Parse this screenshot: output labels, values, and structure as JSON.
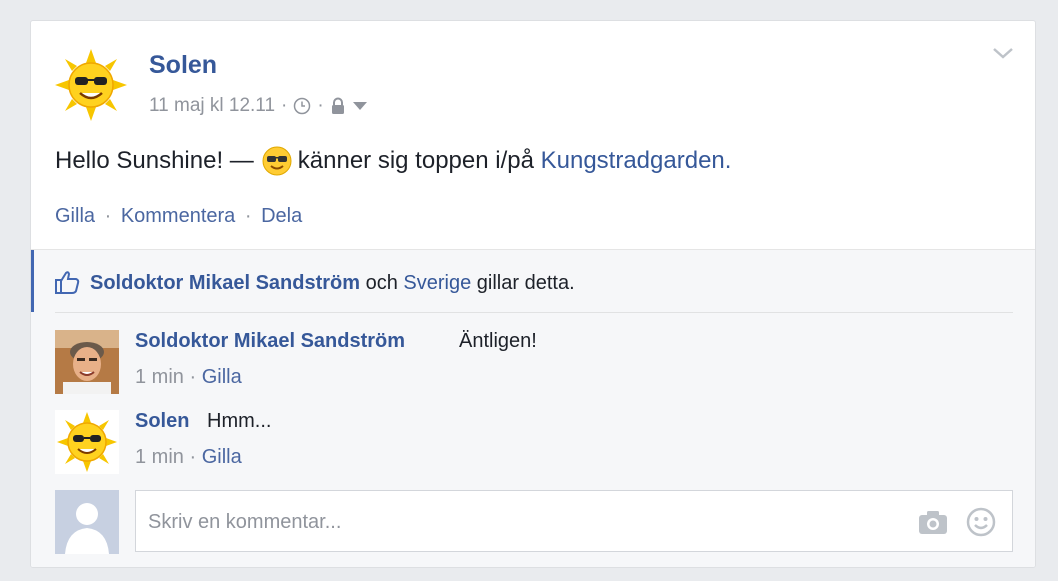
{
  "post": {
    "author": "Solen",
    "date": "11 maj kl 12.11",
    "meta_sep": "·",
    "status_text": "Hello Sunshine! — ",
    "feeling": "känner sig toppen",
    "location_prefix": " i/på ",
    "location": "Kungstradgarden",
    "location_suffix": "."
  },
  "actions": {
    "like": "Gilla",
    "comment": "Kommentera",
    "share": "Dela",
    "sep": "·"
  },
  "likes": {
    "person1": "Soldoktor Mikael Sandström",
    "and": " och ",
    "person2": "Sverige",
    "suffix": " gillar detta."
  },
  "comments": [
    {
      "author": "Soldoktor Mikael Sandström",
      "text": "Äntligen!",
      "time": "1 min",
      "like": "Gilla"
    },
    {
      "author": "Solen",
      "text": "Hmm...",
      "time": "1 min",
      "like": "Gilla"
    }
  ],
  "composer": {
    "placeholder": "Skriv en kommentar..."
  },
  "icons": {
    "header_avatar": "sun-with-sunglasses-icon",
    "privacy": "lock-icon",
    "time": "clock-icon",
    "menu": "chevron-down-icon",
    "like": "thumbs-up-icon",
    "camera": "camera-icon",
    "emoji": "smiley-icon"
  },
  "colors": {
    "link": "#365899",
    "action": "#4b67a1",
    "meta": "#90949c",
    "text": "#1d2129",
    "ufi_bg": "#f6f7f9",
    "accent_bar": "#4267b2"
  }
}
